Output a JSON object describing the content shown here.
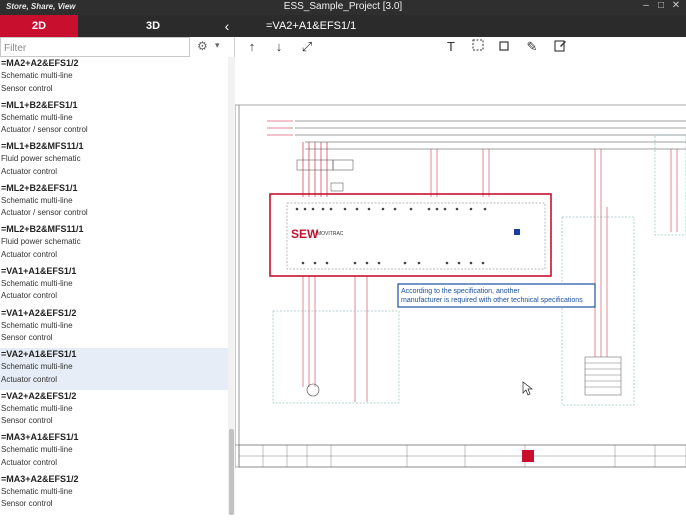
{
  "titlebar": {
    "brand": "Store, Share, View",
    "project": "ESS_Sample_Project [3.0]"
  },
  "tabs": {
    "tab_2d": "2D",
    "tab_3d": "3D",
    "collapse": "‹"
  },
  "page": {
    "title": "=VA2+A1&EFS1/1"
  },
  "filter": {
    "placeholder": "Filter",
    "value": ""
  },
  "sidebar": {
    "items": [
      {
        "title": "=MA2+A2&EFS1/2",
        "line1": "Schematic multi-line",
        "line2": "Sensor control"
      },
      {
        "title": "=ML1+B2&EFS1/1",
        "line1": "Schematic multi-line",
        "line2": "Actuator / sensor control"
      },
      {
        "title": "=ML1+B2&MFS11/1",
        "line1": "Fluid power schematic",
        "line2": "Actuator control"
      },
      {
        "title": "=ML2+B2&EFS1/1",
        "line1": "Schematic multi-line",
        "line2": "Actuator / sensor control"
      },
      {
        "title": "=ML2+B2&MFS11/1",
        "line1": "Fluid power schematic",
        "line2": "Actuator control"
      },
      {
        "title": "=VA1+A1&EFS1/1",
        "line1": "Schematic multi-line",
        "line2": "Actuator control"
      },
      {
        "title": "=VA1+A2&EFS1/2",
        "line1": "Schematic multi-line",
        "line2": "Sensor control"
      },
      {
        "title": "=VA2+A1&EFS1/1",
        "line1": "Schematic multi-line",
        "line2": "Actuator control"
      },
      {
        "title": "=VA2+A2&EFS1/2",
        "line1": "Schematic multi-line",
        "line2": "Sensor control"
      },
      {
        "title": "=MA3+A1&EFS1/1",
        "line1": "Schematic multi-line",
        "line2": "Actuator control"
      },
      {
        "title": "=MA3+A2&EFS1/2",
        "line1": "Schematic multi-line",
        "line2": "Sensor control"
      }
    ],
    "selected_index": 7
  },
  "toolbar": {
    "icons": [
      "arrow-up-icon",
      "arrow-down-icon",
      "fit-screen-icon",
      "text-tool-icon",
      "frame-select-icon",
      "rectangle-tool-icon",
      "pen-tool-icon",
      "edit-note-icon"
    ]
  },
  "schematic": {
    "brand_logo": "SEW",
    "brand_text": "MOVITRAC",
    "annotation_line1": "According to the specification, another",
    "annotation_line2": "manufacturer is required with other technical specifications",
    "highlight_color": "#c8102e",
    "annotation_color": "#1a4fa0"
  }
}
